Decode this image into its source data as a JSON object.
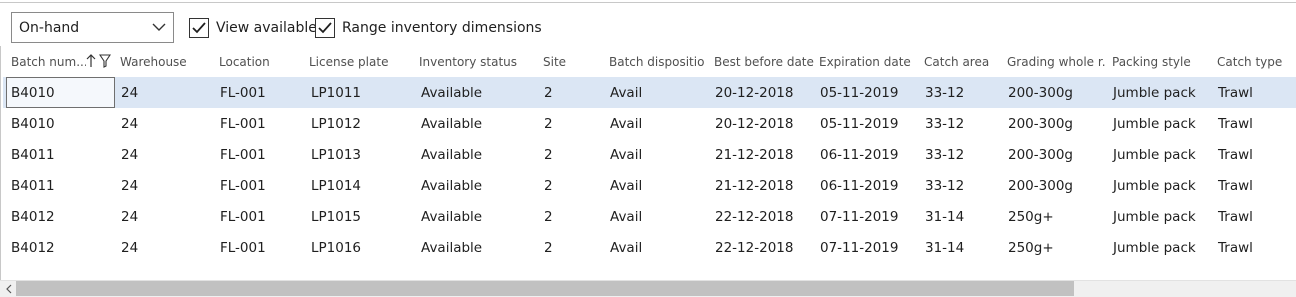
{
  "toolbar": {
    "view_dropdown": {
      "value": "On-hand"
    },
    "view_available": {
      "label": "View available",
      "checked": true
    },
    "range_dimensions": {
      "label": "Range inventory dimensions",
      "checked": true
    }
  },
  "grid": {
    "columns": [
      {
        "key": "batch",
        "label": "Batch num..."
      },
      {
        "key": "warehouse",
        "label": "Warehouse"
      },
      {
        "key": "location",
        "label": "Location"
      },
      {
        "key": "license_plate",
        "label": "License plate"
      },
      {
        "key": "inventory_status",
        "label": "Inventory status"
      },
      {
        "key": "site",
        "label": "Site"
      },
      {
        "key": "batch_disposition",
        "label": "Batch dispositio..."
      },
      {
        "key": "best_before",
        "label": "Best before date"
      },
      {
        "key": "expiration",
        "label": "Expiration date"
      },
      {
        "key": "catch_area",
        "label": "Catch area"
      },
      {
        "key": "grading",
        "label": "Grading whole r..."
      },
      {
        "key": "packing_style",
        "label": "Packing style"
      },
      {
        "key": "catch_type",
        "label": "Catch type"
      }
    ],
    "rows": [
      [
        "B4010",
        "24",
        "FL-001",
        "LP1011",
        "Available",
        "2",
        "Avail",
        "20-12-2018",
        "05-11-2019",
        "33-12",
        "200-300g",
        "Jumble pack",
        "Trawl"
      ],
      [
        "B4010",
        "24",
        "FL-001",
        "LP1012",
        "Available",
        "2",
        "Avail",
        "20-12-2018",
        "05-11-2019",
        "33-12",
        "200-300g",
        "Jumble pack",
        "Trawl"
      ],
      [
        "B4011",
        "24",
        "FL-001",
        "LP1013",
        "Available",
        "2",
        "Avail",
        "21-12-2018",
        "06-11-2019",
        "33-12",
        "200-300g",
        "Jumble pack",
        "Trawl"
      ],
      [
        "B4011",
        "24",
        "FL-001",
        "LP1014",
        "Available",
        "2",
        "Avail",
        "21-12-2018",
        "06-11-2019",
        "33-12",
        "200-300g",
        "Jumble pack",
        "Trawl"
      ],
      [
        "B4012",
        "24",
        "FL-001",
        "LP1015",
        "Available",
        "2",
        "Avail",
        "22-12-2018",
        "07-11-2019",
        "31-14",
        "250g+",
        "Jumble pack",
        "Trawl"
      ],
      [
        "B4012",
        "24",
        "FL-001",
        "LP1016",
        "Available",
        "2",
        "Avail",
        "22-12-2018",
        "07-11-2019",
        "31-14",
        "250g+",
        "Jumble pack",
        "Trawl"
      ]
    ],
    "selected_row": 0
  },
  "colors": {
    "selected_row": "#dbe6f4",
    "scroll_thumb": "#c1c1c1"
  }
}
